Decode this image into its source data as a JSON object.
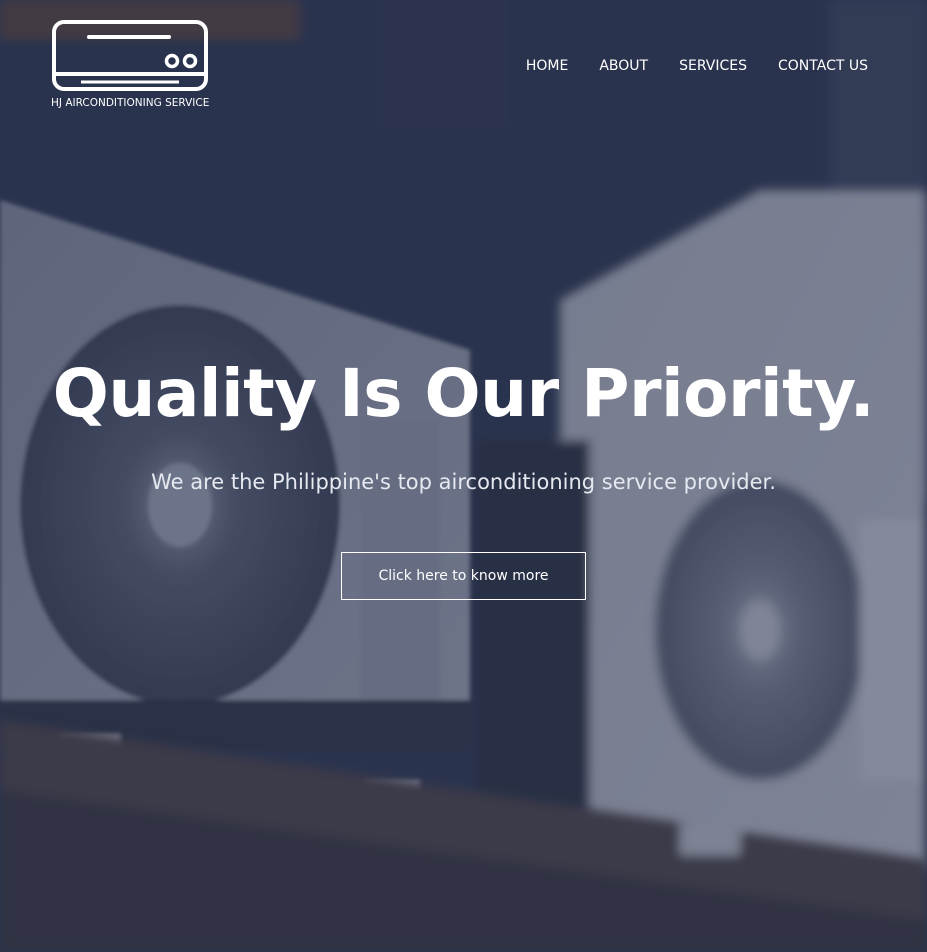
{
  "brand": {
    "name": "HJ AIRCONDITIONING SERVICE",
    "logo_icon": "aircon-unit-icon"
  },
  "nav": {
    "items": [
      {
        "label": "HOME"
      },
      {
        "label": "ABOUT"
      },
      {
        "label": "SERVICES"
      },
      {
        "label": "CONTACT US"
      }
    ]
  },
  "hero": {
    "headline": "Quality Is Our Priority.",
    "subtitle": "We are the Philippine's top airconditioning service provider.",
    "cta_label": "Click here to know more",
    "background_image": "air-conditioner-outdoor-units-photo"
  },
  "colors": {
    "overlay": "#262e4a",
    "text": "#ffffff"
  }
}
